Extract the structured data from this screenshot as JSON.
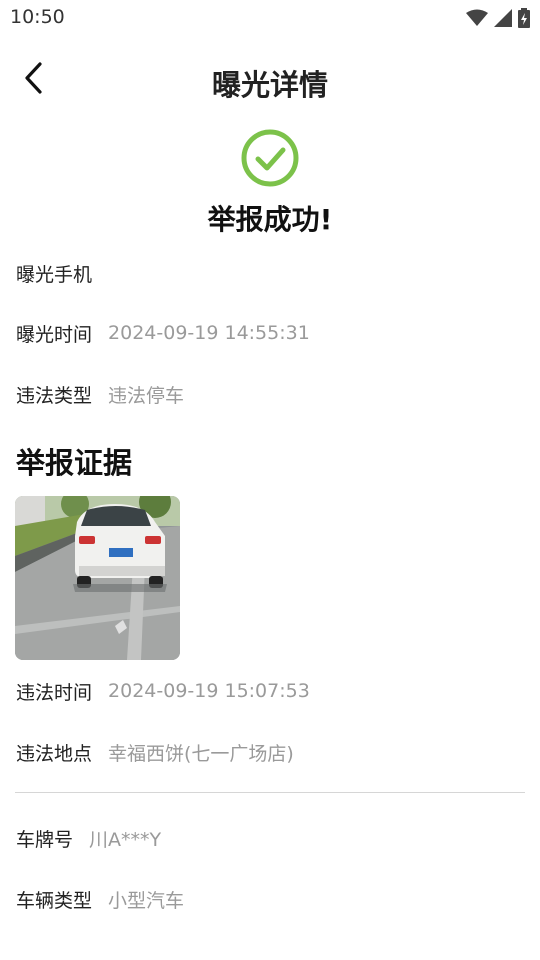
{
  "status_bar": {
    "time": "10:50"
  },
  "header": {
    "title": "曝光详情"
  },
  "result": {
    "message": "举报成功!",
    "accent_color": "#7cc24a"
  },
  "info": {
    "phone_label": "曝光手机",
    "phone_value": "",
    "time_label": "曝光时间",
    "time_value": "2024-09-19 14:55:31",
    "type_label": "违法类型",
    "type_value": "违法停车"
  },
  "evidence": {
    "title": "举报证据",
    "violation_time_label": "违法时间",
    "violation_time_value": "2024-09-19 15:07:53",
    "location_label": "违法地点",
    "location_value": "幸福西饼(七一广场店)"
  },
  "vehicle": {
    "plate_label": "车牌号",
    "plate_value": "川A***Y",
    "type_label": "车辆类型",
    "type_value": "小型汽车"
  },
  "icons": {
    "back": "chevron-left-icon",
    "success": "check-circle-icon",
    "wifi": "wifi-icon",
    "signal": "signal-icon",
    "battery": "battery-icon"
  }
}
